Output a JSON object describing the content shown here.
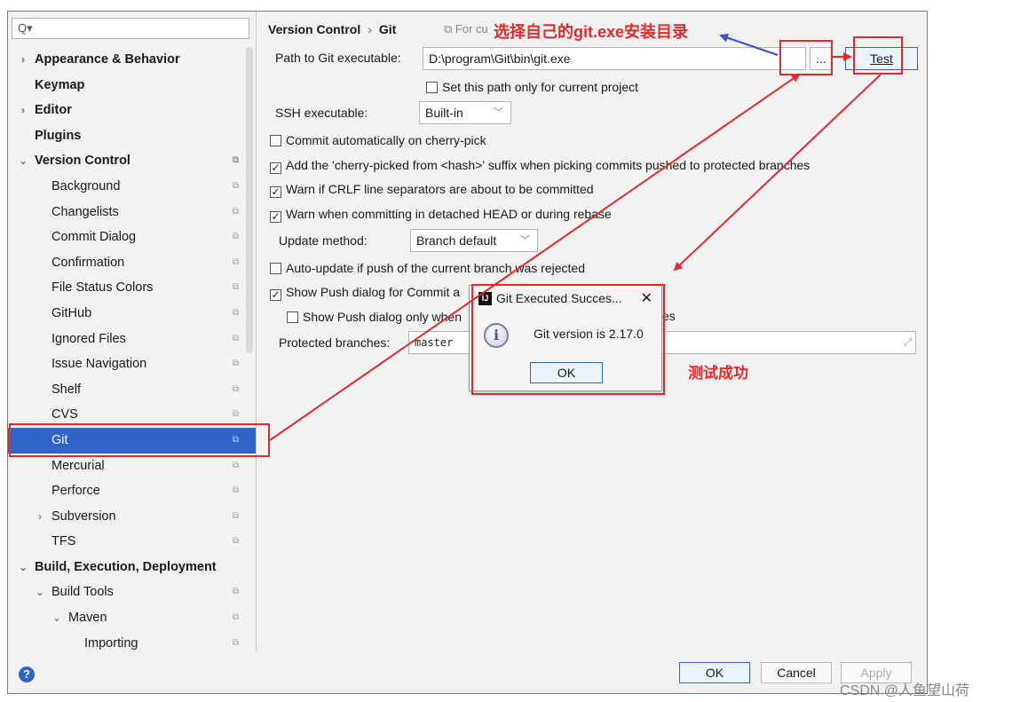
{
  "sidebar": {
    "search_placeholder": "",
    "items": [
      {
        "label": "Appearance & Behavior",
        "bold": true,
        "level": 0,
        "arrow": "›",
        "mark": false
      },
      {
        "label": "Keymap",
        "bold": true,
        "level": 0,
        "arrow": "",
        "mark": false
      },
      {
        "label": "Editor",
        "bold": true,
        "level": 0,
        "arrow": "›",
        "mark": false
      },
      {
        "label": "Plugins",
        "bold": true,
        "level": 0,
        "arrow": "",
        "mark": false
      },
      {
        "label": "Version Control",
        "bold": true,
        "level": 0,
        "arrow": "⌄",
        "mark": true
      },
      {
        "label": "Background",
        "bold": false,
        "level": 1,
        "arrow": "",
        "mark": true
      },
      {
        "label": "Changelists",
        "bold": false,
        "level": 1,
        "arrow": "",
        "mark": true
      },
      {
        "label": "Commit Dialog",
        "bold": false,
        "level": 1,
        "arrow": "",
        "mark": true
      },
      {
        "label": "Confirmation",
        "bold": false,
        "level": 1,
        "arrow": "",
        "mark": true
      },
      {
        "label": "File Status Colors",
        "bold": false,
        "level": 1,
        "arrow": "",
        "mark": true
      },
      {
        "label": "GitHub",
        "bold": false,
        "level": 1,
        "arrow": "",
        "mark": true
      },
      {
        "label": "Ignored Files",
        "bold": false,
        "level": 1,
        "arrow": "",
        "mark": true
      },
      {
        "label": "Issue Navigation",
        "bold": false,
        "level": 1,
        "arrow": "",
        "mark": true
      },
      {
        "label": "Shelf",
        "bold": false,
        "level": 1,
        "arrow": "",
        "mark": true
      },
      {
        "label": "CVS",
        "bold": false,
        "level": 1,
        "arrow": "",
        "mark": true
      },
      {
        "label": "Git",
        "bold": false,
        "level": 1,
        "arrow": "",
        "mark": true,
        "selected": true
      },
      {
        "label": "Mercurial",
        "bold": false,
        "level": 1,
        "arrow": "",
        "mark": true
      },
      {
        "label": "Perforce",
        "bold": false,
        "level": 1,
        "arrow": "",
        "mark": true
      },
      {
        "label": "Subversion",
        "bold": false,
        "level": 1,
        "arrow": "›",
        "mark": true
      },
      {
        "label": "TFS",
        "bold": false,
        "level": 1,
        "arrow": "",
        "mark": true
      },
      {
        "label": "Build, Execution, Deployment",
        "bold": true,
        "level": 0,
        "arrow": "⌄",
        "mark": false
      },
      {
        "label": "Build Tools",
        "bold": false,
        "level": 1,
        "arrow": "⌄",
        "mark": true
      },
      {
        "label": "Maven",
        "bold": false,
        "level": 2,
        "arrow": "⌄",
        "mark": true
      },
      {
        "label": "Importing",
        "bold": false,
        "level": 3,
        "arrow": "",
        "mark": true
      }
    ]
  },
  "breadcrumb": {
    "parent": "Version Control",
    "separator": "›",
    "current": "Git"
  },
  "header_note": "For cu",
  "git_path": {
    "label": "Path to Git executable:",
    "value": "D:\\program\\Git\\bin\\git.exe",
    "browse_label": "...",
    "test_label": "Test"
  },
  "options": {
    "set_path_only": {
      "label": "Set this path only for current project",
      "checked": false
    },
    "ssh_label": "SSH executable:",
    "ssh_value": "Built-in",
    "commit_cherry": {
      "label": "Commit automatically on cherry-pick",
      "checked": false
    },
    "cherry_suffix": {
      "label": "Add the 'cherry-picked from <hash>' suffix when picking commits pushed to protected branches",
      "checked": true
    },
    "warn_crlf": {
      "label": "Warn if CRLF line separators are about to be committed",
      "checked": true
    },
    "warn_detached": {
      "label": "Warn when committing in detached HEAD or during rebase",
      "checked": true
    },
    "update_method_label": "Update method:",
    "update_method_value": "Branch default",
    "auto_update": {
      "label": "Auto-update if push of the current branch was rejected",
      "checked": false
    },
    "show_push": {
      "label": "Show Push dialog for Commit a",
      "checked": true
    },
    "show_push_only": {
      "label": "Show Push dialog only when",
      "checked": false,
      "tail": "es"
    },
    "protected_label": "Protected branches:",
    "protected_value": "master"
  },
  "popup": {
    "title": "Git Executed Succes...",
    "logo": "IJ",
    "close": "✕",
    "info_icon": "i",
    "message": "Git version is 2.17.0",
    "ok_label": "OK"
  },
  "bottom": {
    "help": "?",
    "ok_label": "OK",
    "cancel_label": "Cancel",
    "apply_label": "Apply"
  },
  "annotations": {
    "select_dir": "选择自己的git.exe安装目录",
    "test_success": "测试成功",
    "red": "#e52a2a",
    "blue": "#3a4fcf"
  },
  "watermark": "CSDN @人鱼望山荷",
  "colors": {
    "accent": "#2f65ca",
    "panel": "#f2f2f2"
  }
}
